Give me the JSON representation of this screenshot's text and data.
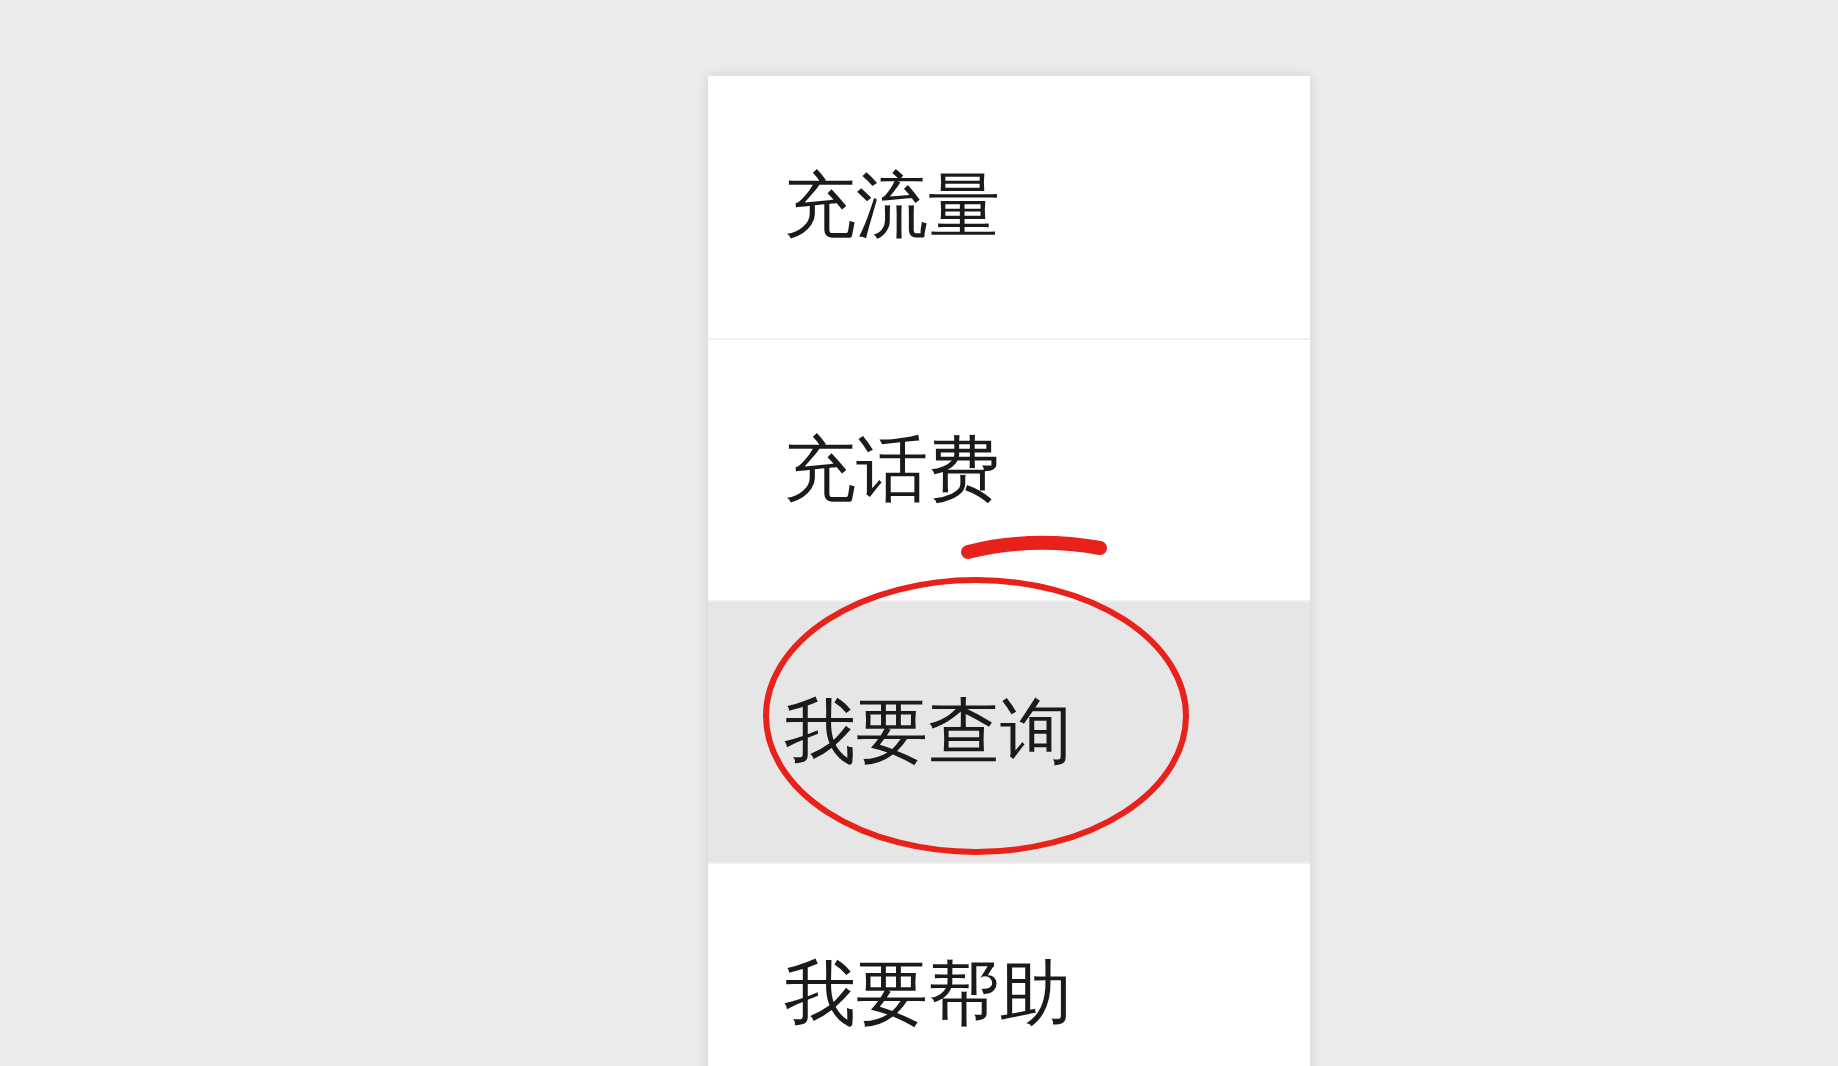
{
  "menu": {
    "items": [
      {
        "label": "充流量",
        "selected": false
      },
      {
        "label": "充话费",
        "selected": false
      },
      {
        "label": "我要查询",
        "selected": true
      },
      {
        "label": "我要帮助",
        "selected": false
      }
    ]
  }
}
